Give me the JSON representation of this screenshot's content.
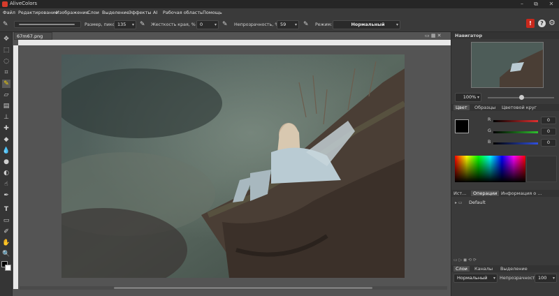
{
  "app": {
    "title": "AliveColors"
  },
  "window_controls": {
    "minimize": "–",
    "maximize": "⧉",
    "close": "✕"
  },
  "menu": [
    "Файл",
    "Редактирование",
    "Изображение",
    "Слои",
    "Выделение",
    "Эффекты",
    "AI",
    "Рабочая область",
    "Помощь"
  ],
  "tool_options": {
    "size_label": "Размер, пикс:",
    "size_value": "135",
    "hardness_label": "Жесткость края, %",
    "hardness_value": "0",
    "opacity_label": "Непрозрачность, %",
    "opacity_value": "59",
    "mode_label": "Режим:",
    "mode_value": "Нормальный"
  },
  "document": {
    "tab_label": "67m67.png"
  },
  "navigator": {
    "title": "Навигатор",
    "zoom": "100%"
  },
  "color_panel": {
    "tabs": [
      "Цвет",
      "Образцы",
      "Цветовой круг"
    ],
    "channels": [
      {
        "label": "R",
        "value": "0",
        "color": "#e03030"
      },
      {
        "label": "G",
        "value": "0",
        "color": "#2fc02f"
      },
      {
        "label": "B",
        "value": "0",
        "color": "#3050e0"
      }
    ]
  },
  "history_panel": {
    "tabs": [
      "Ист...",
      "Операции",
      "Информация о ..."
    ],
    "items": [
      "Default"
    ]
  },
  "layers_panel": {
    "tabs": [
      "Слои",
      "Каналы",
      "Выделение"
    ],
    "blend_mode": "Нормальный",
    "opacity_label": "Непрозрачность",
    "opacity_value": "100"
  },
  "colors": {
    "accent": "#d63b2b",
    "bg": "#3a3a3a",
    "canvas_bg": "#545454"
  }
}
